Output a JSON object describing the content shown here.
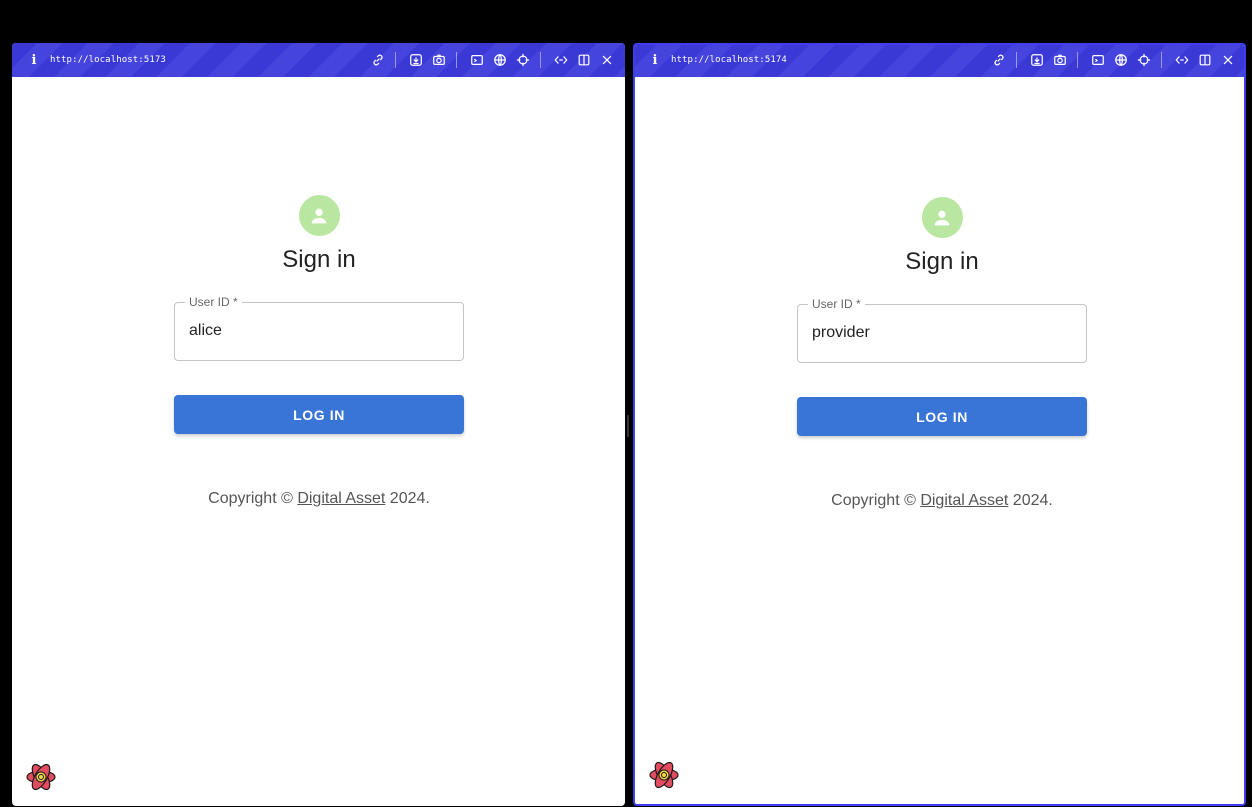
{
  "panes": [
    {
      "url": "http://localhost:5173",
      "form": {
        "title": "Sign in",
        "field_label": "User ID *",
        "field_value": "alice",
        "button_label": "LOG IN",
        "copyright_prefix": "Copyright © ",
        "copyright_link": "Digital Asset",
        "copyright_suffix": " 2024."
      }
    },
    {
      "url": "http://localhost:5174",
      "form": {
        "title": "Sign in",
        "field_label": "User ID *",
        "field_value": "provider",
        "button_label": "LOG IN",
        "copyright_prefix": "Copyright © ",
        "copyright_link": "Digital Asset",
        "copyright_suffix": " 2024."
      }
    }
  ],
  "toolbar_icons": [
    "info-icon",
    "link-icon",
    "download-icon",
    "camera-icon",
    "terminal-icon",
    "globe-icon",
    "crosshair-icon",
    "code-icon",
    "split-icon",
    "close-icon"
  ],
  "colors": {
    "bar": "#3a39d6",
    "avatar": "#b9e6a0",
    "button": "#3975d6",
    "active_border": "#3d3df2"
  }
}
